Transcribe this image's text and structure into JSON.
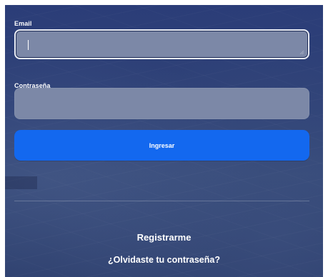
{
  "login_form": {
    "email_label": "Email",
    "email_value": "",
    "password_label": "Contraseña",
    "password_value": "",
    "submit_label": "Ingresar",
    "register_link": "Registrarme",
    "forgot_link": "¿Olvidaste tu contraseña?"
  },
  "colors": {
    "background": "#2f4276",
    "field_fill": "#7c88a7",
    "primary_button": "#1368ef",
    "text": "#ffffff"
  },
  "icons": {
    "email_field_corner": "resize-grip-icon"
  }
}
